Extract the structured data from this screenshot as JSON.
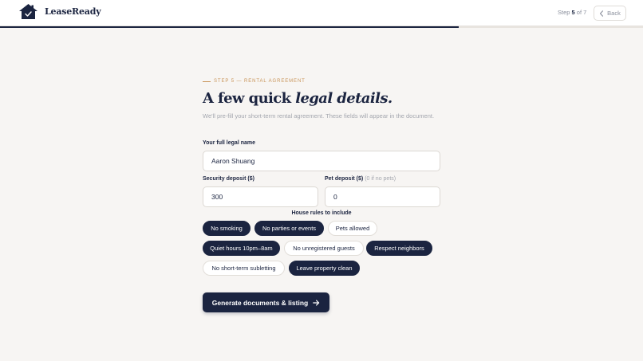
{
  "app": {
    "brand": "LeaseReady",
    "colors": {
      "primary": "#1b2440",
      "accent": "#c9955a",
      "background": "#f7f5f3"
    }
  },
  "header": {
    "step_prefix": "Step",
    "step_current": "5",
    "step_sep": "of",
    "step_total": "7",
    "back_label": "Back",
    "logo_icon": "house-check-icon",
    "back_icon": "chevron-left-icon"
  },
  "progress": {
    "fraction": 0.714
  },
  "main": {
    "eyebrow": "Step 5 — Rental Agreement",
    "title_plain": "A few quick ",
    "title_italic": "legal details.",
    "subtitle": "We'll pre-fill your short-term rental agreement. These fields will appear in the document."
  },
  "form": {
    "name_label": "Your full legal name",
    "name_value": "Aaron Shuang",
    "deposit_label": "Security deposit ($)",
    "deposit_value": "300",
    "pet_label": "Pet deposit ($)",
    "pet_hint": "(0 if no pets)",
    "pet_value": "0",
    "rules_label": "House rules to include",
    "rules": [
      {
        "label": "No smoking",
        "selected": true
      },
      {
        "label": "No parties or events",
        "selected": true
      },
      {
        "label": "Pets allowed",
        "selected": false
      },
      {
        "label": "Quiet hours 10pm–8am",
        "selected": true
      },
      {
        "label": "No unregistered guests",
        "selected": false
      },
      {
        "label": "Respect neighbors",
        "selected": true
      },
      {
        "label": "No short-term subletting",
        "selected": false
      },
      {
        "label": "Leave property clean",
        "selected": true
      }
    ],
    "submit_label": "Generate documents & listing",
    "submit_icon": "arrow-right-icon"
  }
}
